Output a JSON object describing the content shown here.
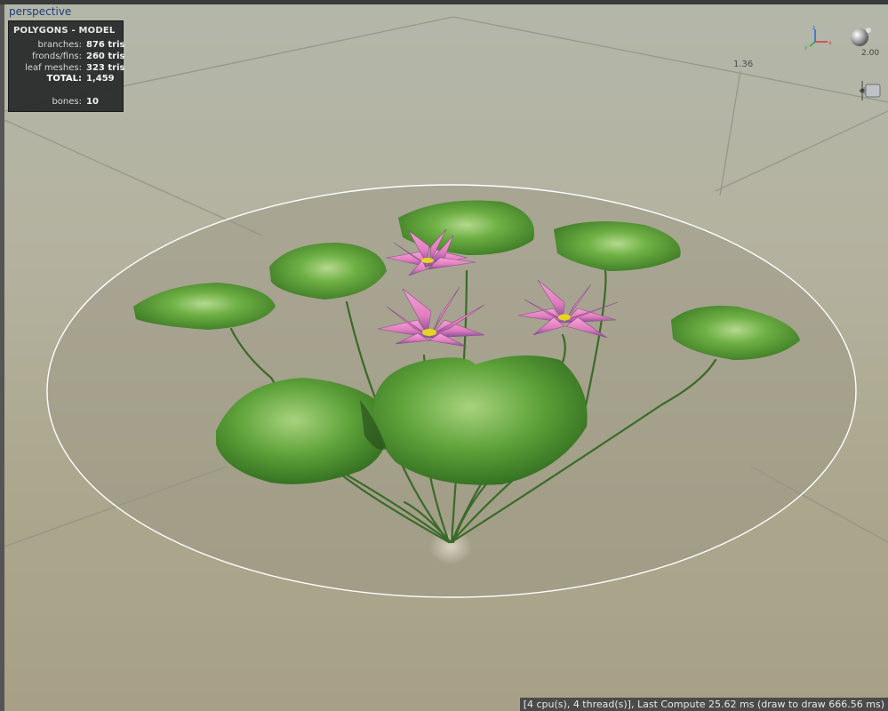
{
  "viewport": {
    "label": "perspective",
    "dimension_label": "1.36",
    "zoom_value": "2.00",
    "gizmo_axes": [
      "z",
      "y",
      "x"
    ]
  },
  "stats": {
    "title": "POLYGONS - MODEL",
    "rows": [
      {
        "label": "branches:",
        "value": "876 tris"
      },
      {
        "label": "fronds/fins:",
        "value": "260 tris"
      },
      {
        "label": "leaf meshes:",
        "value": "323 tris"
      },
      {
        "label": "TOTAL:",
        "value": "1,459"
      },
      {
        "label": "bones:",
        "value": "10"
      }
    ]
  },
  "status_bar": {
    "text": "[4 cpu(s), 4 thread(s)], Last Compute 25.62 ms (draw to draw 666.56 ms)"
  },
  "icons": {
    "gizmo": "axis-gizmo-icon",
    "sphere": "light-sphere-icon",
    "camera": "camera-icon"
  },
  "colors": {
    "leaf": "#5ea33a",
    "leaf_dark": "#3f7d27",
    "petal": "#e27fbd",
    "stamen": "#e7d421",
    "stats_bg": "#262828",
    "status_bg": "#4a4a4a",
    "viewport_label": "#1f3c7a"
  }
}
